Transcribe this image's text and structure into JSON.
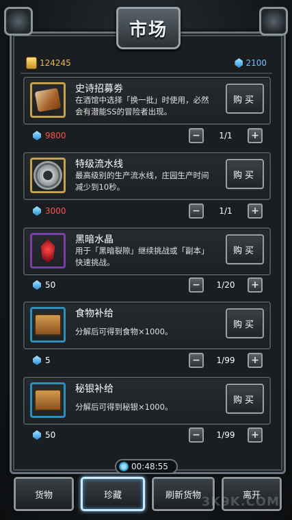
{
  "title": "市场",
  "currency": {
    "gold": "124245",
    "gems": "2100"
  },
  "items": [
    {
      "name": "史诗招募劵",
      "desc": "在酒馆中选择「换一批」时使用，必然会有潜能SS的冒险者出现。",
      "buy": "购买",
      "price": "9800",
      "qty": "1/1"
    },
    {
      "name": "特级流水线",
      "desc": "最高级别的生产流水线，庄园生产时间减少到10秒。",
      "buy": "购买",
      "price": "3000",
      "qty": "1/1"
    },
    {
      "name": "黑暗水晶",
      "desc": "用于「黑暗裂隙」继续挑战或「副本」快速挑战。",
      "buy": "购买",
      "price": "50",
      "qty": "1/20"
    },
    {
      "name": "食物补给",
      "desc": "分解后可得到食物×1000。",
      "buy": "购买",
      "price": "5",
      "qty": "1/99"
    },
    {
      "name": "秘银补给",
      "desc": "分解后可得到秘银×1000。",
      "buy": "购买",
      "price": "50",
      "qty": "1/99"
    }
  ],
  "stepper": {
    "minus": "−",
    "plus": "+"
  },
  "timer": "00:48:55",
  "nav": {
    "goods": "货物",
    "treasure": "珍藏",
    "refresh": "刷新货物",
    "leave": "离开"
  },
  "watermark": "3K9K.COM",
  "colors": {
    "price_insufficient": "#ff5050",
    "gold": "#e9b94a",
    "gem": "#6ec3ff"
  }
}
